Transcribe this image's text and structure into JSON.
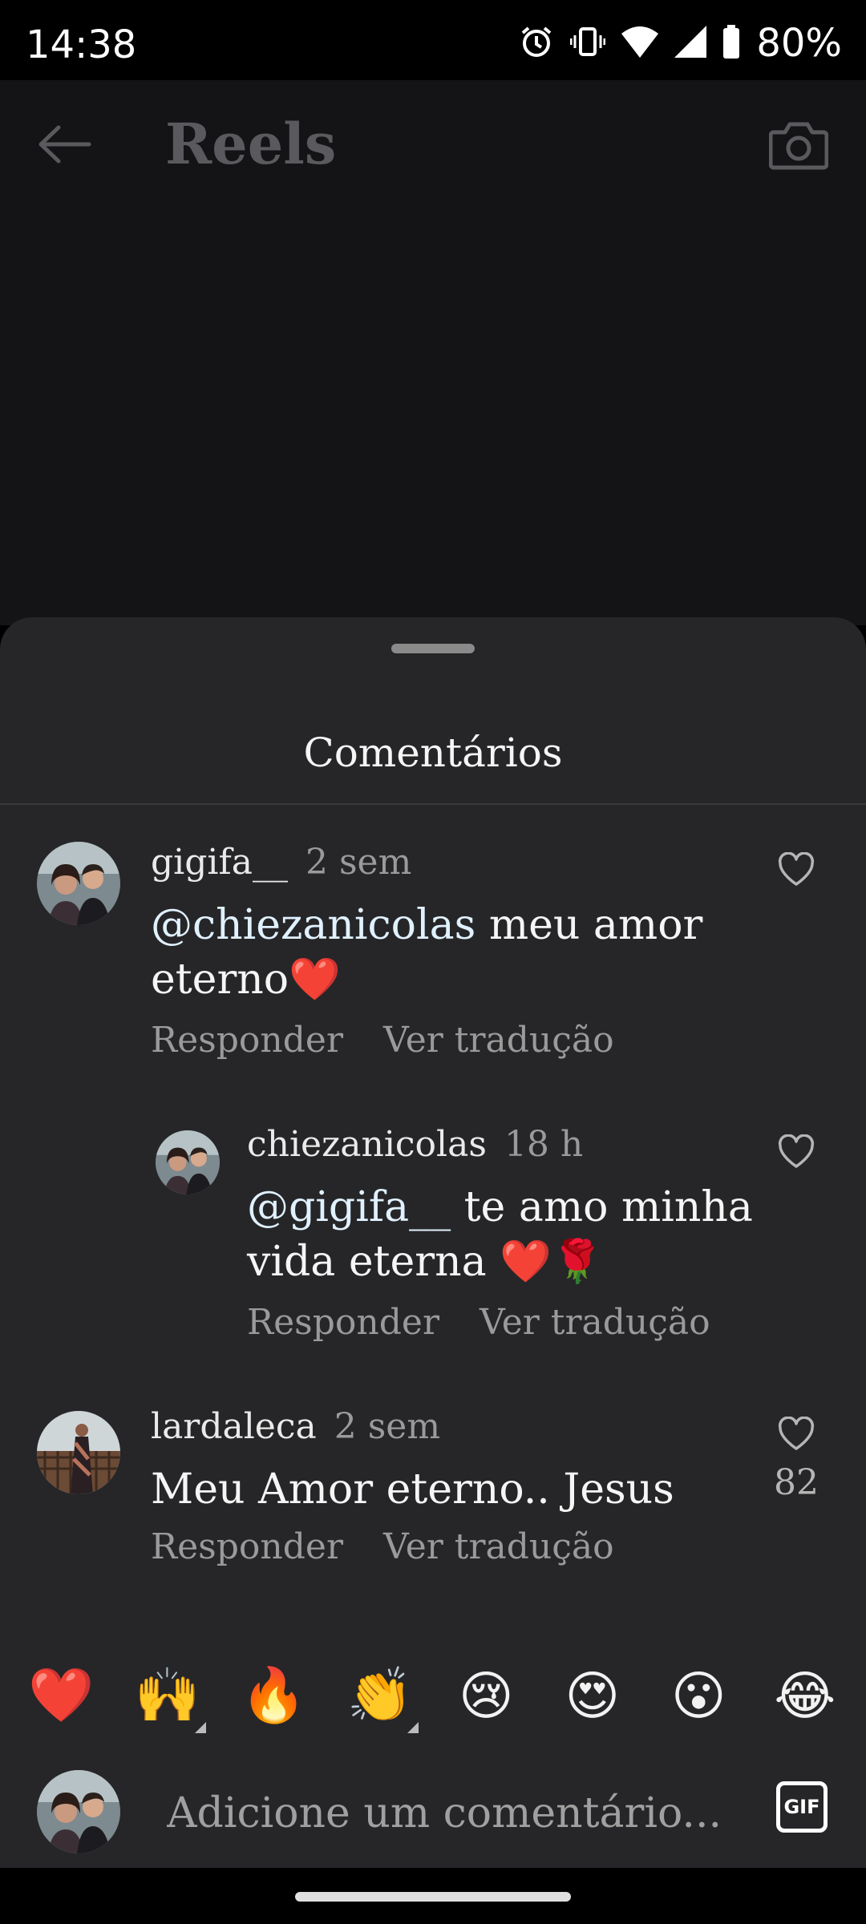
{
  "status_bar": {
    "time": "14:38",
    "battery": "80%"
  },
  "header": {
    "title": "Reels"
  },
  "sheet": {
    "title": "Comentários"
  },
  "comments": [
    {
      "username": "gigifa__",
      "time": "2 sem",
      "mention": "@chiezanicolas",
      "text_line1": " meu amor",
      "text_line2": "eterno❤️",
      "reply_label": "Responder",
      "translate_label": "Ver tradução"
    },
    {
      "username": "chiezanicolas",
      "time": "18 h",
      "mention": "@gigifa__",
      "text_line1": " te amo minha",
      "text_line2": "vida eterna ❤️🌹",
      "reply_label": "Responder",
      "translate_label": "Ver tradução"
    },
    {
      "username": "lardaleca",
      "time": "2 sem",
      "text_line1": "Meu Amor eterno.. Jesus",
      "likes": "82",
      "reply_label": "Responder",
      "translate_label": "Ver tradução"
    }
  ],
  "emoji_bar": [
    "❤️",
    "🙌",
    "🔥",
    "👏",
    "😢",
    "😍",
    "😮",
    "😂"
  ],
  "input": {
    "placeholder": "Adicione um comentário...",
    "gif_label": "GIF"
  },
  "colors": {
    "sheet_bg": "#262628",
    "header_bg": "#141416",
    "muted_text": "#9a9a9a",
    "mention": "#e0f1ff"
  }
}
